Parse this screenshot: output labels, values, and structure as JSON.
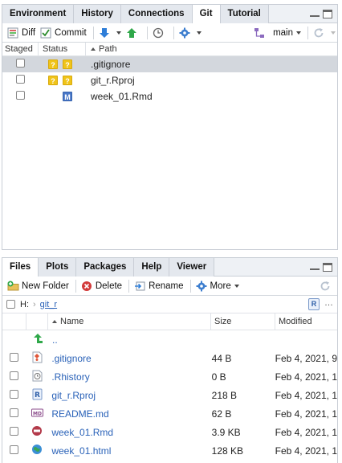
{
  "git_pane": {
    "tabs": [
      {
        "label": "Environment",
        "active": false
      },
      {
        "label": "History",
        "active": false
      },
      {
        "label": "Connections",
        "active": false
      },
      {
        "label": "Git",
        "active": true
      },
      {
        "label": "Tutorial",
        "active": false
      }
    ],
    "toolbar": {
      "diff_label": "Diff",
      "commit_label": "Commit",
      "branch_label": "main"
    },
    "columns": {
      "staged": "Staged",
      "status": "Status",
      "path": "Path"
    },
    "rows": [
      {
        "path": ".gitignore",
        "status": [
          "?",
          "?"
        ],
        "selected": true
      },
      {
        "path": "git_r.Rproj",
        "status": [
          "?",
          "?"
        ],
        "selected": false
      },
      {
        "path": "week_01.Rmd",
        "status": [
          "",
          "M"
        ],
        "selected": false
      }
    ]
  },
  "files_pane": {
    "tabs": [
      {
        "label": "Files",
        "active": true
      },
      {
        "label": "Plots",
        "active": false
      },
      {
        "label": "Packages",
        "active": false
      },
      {
        "label": "Help",
        "active": false
      },
      {
        "label": "Viewer",
        "active": false
      }
    ],
    "toolbar": {
      "new_folder_label": "New Folder",
      "delete_label": "Delete",
      "rename_label": "Rename",
      "more_label": "More"
    },
    "breadcrumb": {
      "root": "H:",
      "folder": "git_r",
      "project_badge": "R",
      "more": "…"
    },
    "columns": {
      "name": "Name",
      "size": "Size",
      "modified": "Modified"
    },
    "parent_label": "..",
    "files": [
      {
        "name": ".gitignore",
        "size": "44 B",
        "modified": "Feb 4, 2021, 9",
        "icon": "gitignore-file-icon"
      },
      {
        "name": ".Rhistory",
        "size": "0 B",
        "modified": "Feb 4, 2021, 1",
        "icon": "rhistory-file-icon"
      },
      {
        "name": "git_r.Rproj",
        "size": "218 B",
        "modified": "Feb 4, 2021, 1",
        "icon": "rproj-file-icon"
      },
      {
        "name": "README.md",
        "size": "62 B",
        "modified": "Feb 4, 2021, 1",
        "icon": "markdown-file-icon"
      },
      {
        "name": "week_01.Rmd",
        "size": "3.9 KB",
        "modified": "Feb 4, 2021, 1",
        "icon": "rmarkdown-file-icon"
      },
      {
        "name": "week_01.html",
        "size": "128 KB",
        "modified": "Feb 4, 2021, 1",
        "icon": "html-file-icon"
      }
    ]
  },
  "colors": {
    "accent_blue": "#2a62b8",
    "status_unknown": "#f0c419",
    "status_modified": "#4a78c8",
    "selected_row": "#d3d7dd",
    "tabbar_bg": "#eef1f5"
  }
}
